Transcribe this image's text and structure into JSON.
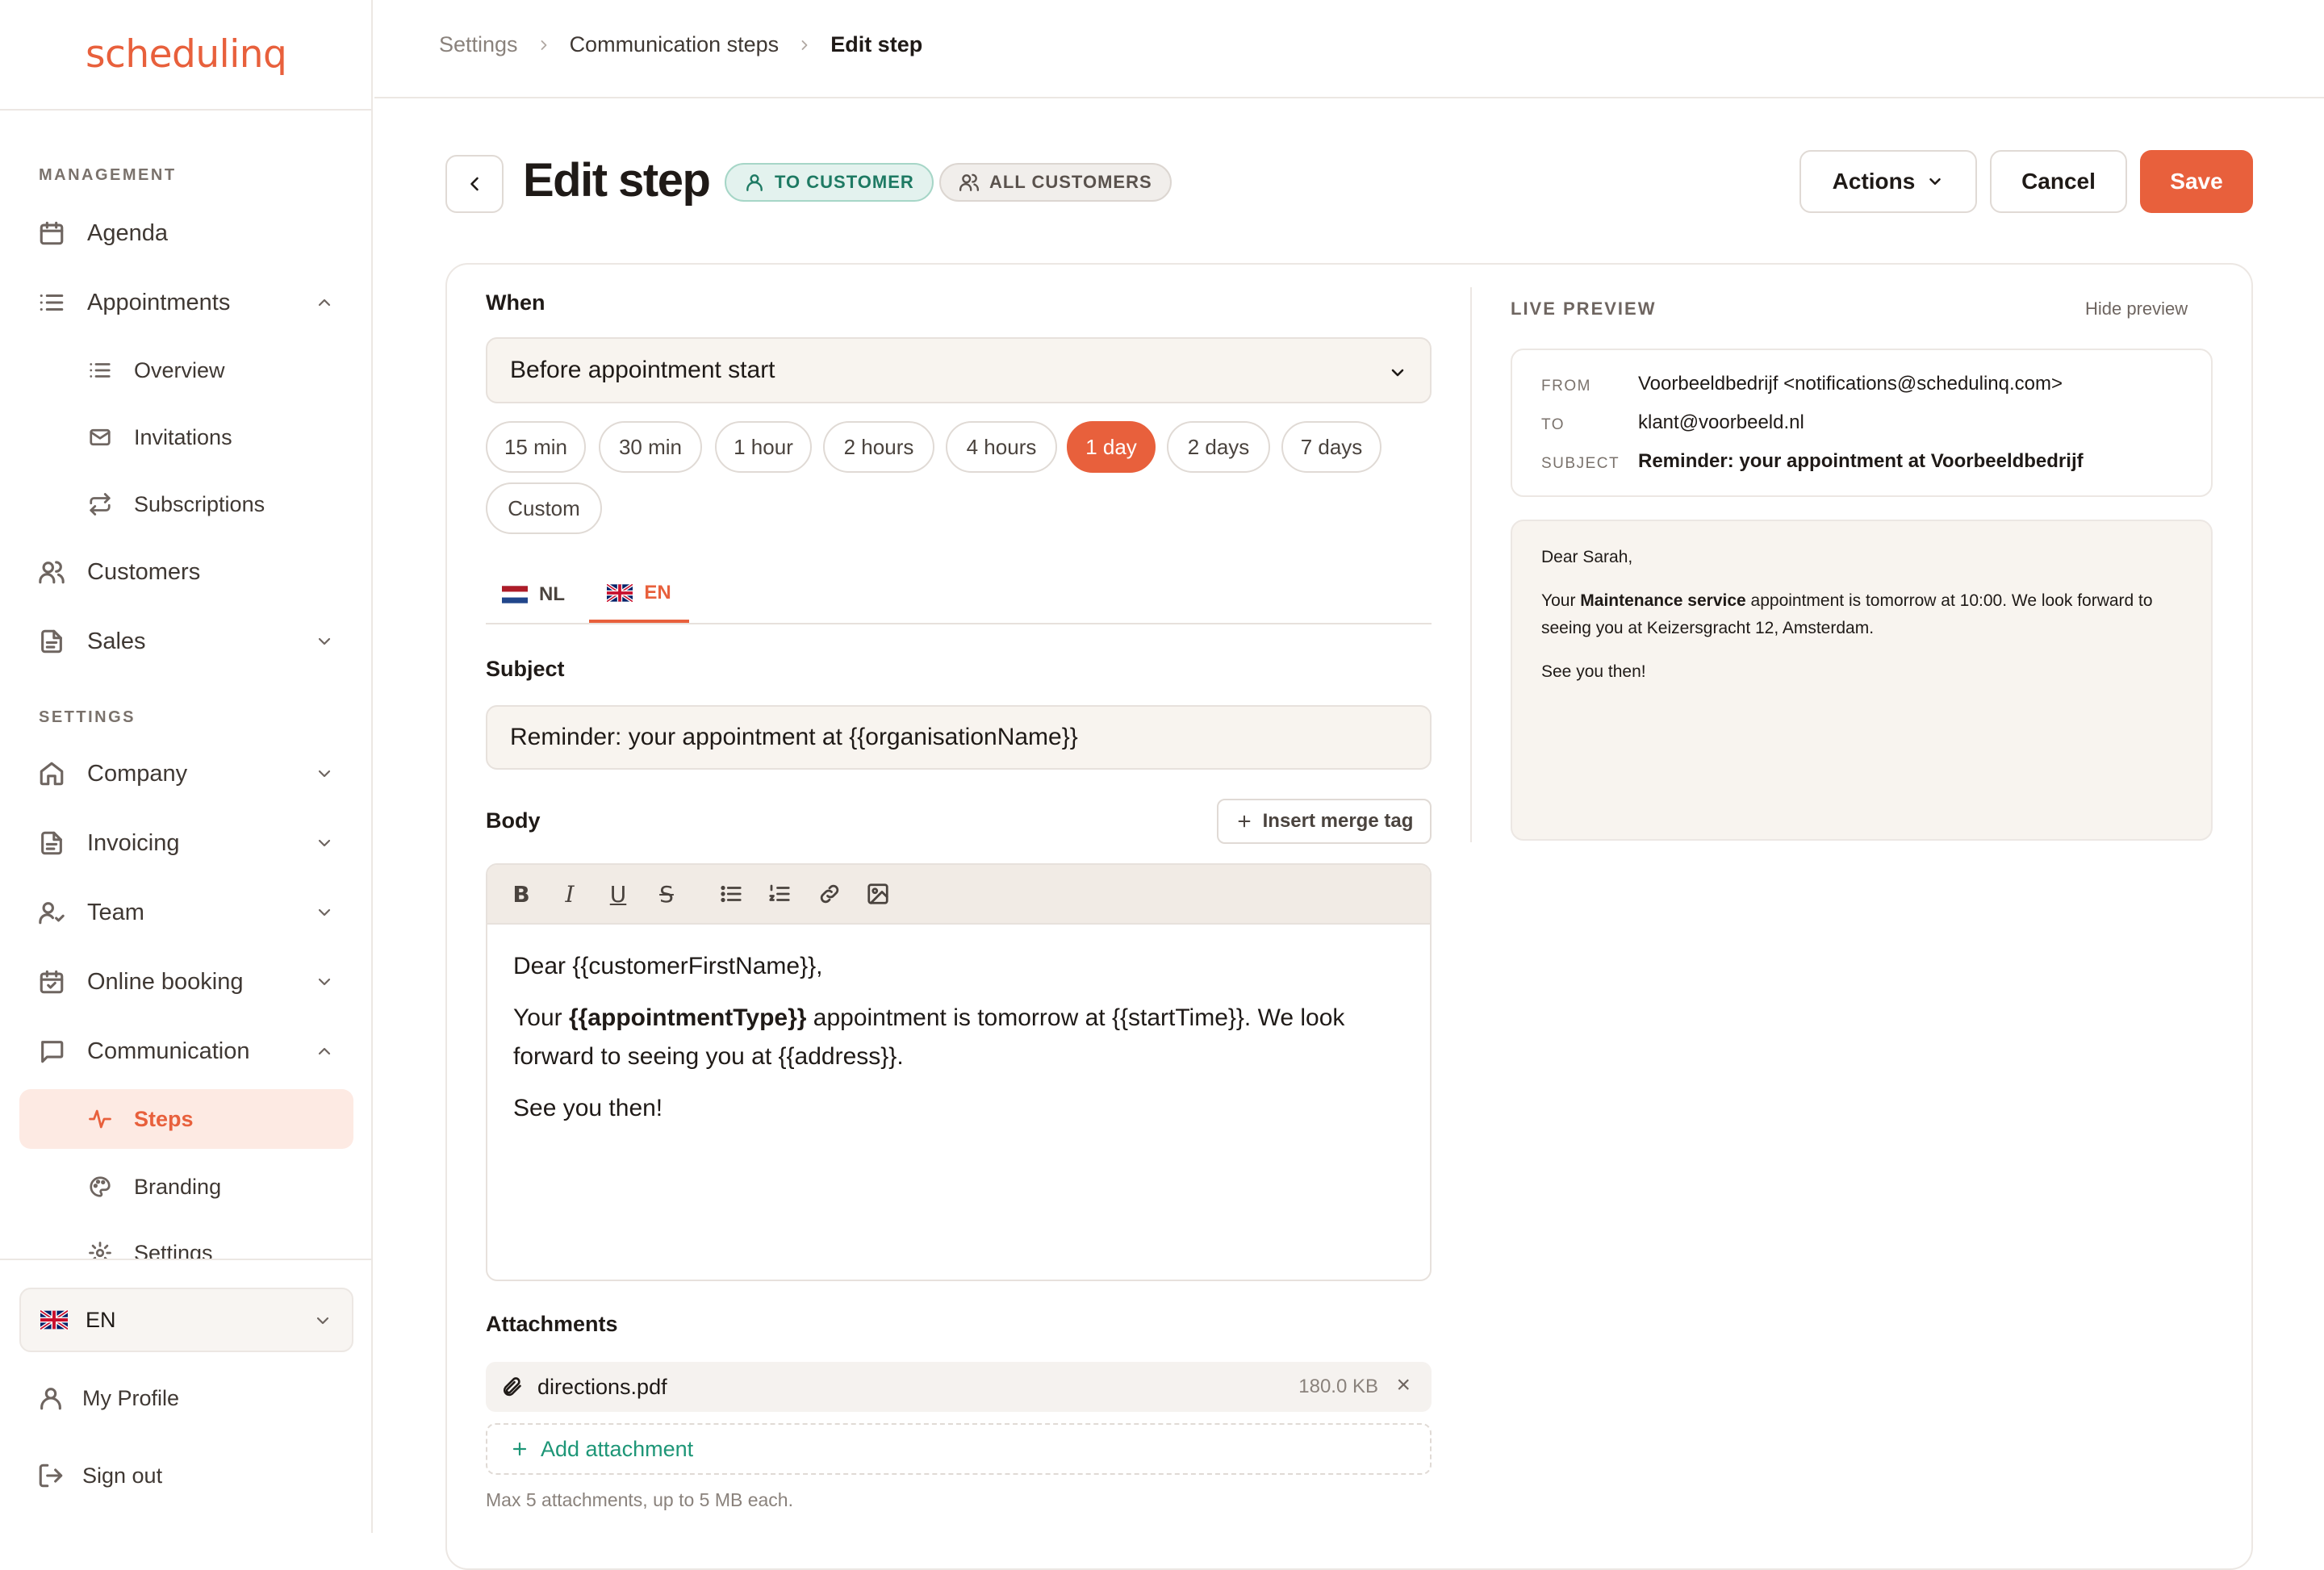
{
  "app": {
    "logo": "schedulinq"
  },
  "sidebar": {
    "management_label": "MANAGEMENT",
    "settings_label": "SETTINGS",
    "items": {
      "agenda": "Agenda",
      "appointments": "Appointments",
      "overview": "Overview",
      "invitations": "Invitations",
      "subscriptions": "Subscriptions",
      "customers": "Customers",
      "sales": "Sales",
      "company": "Company",
      "invoicing": "Invoicing",
      "team": "Team",
      "online_booking": "Online booking",
      "communication": "Communication",
      "steps": "Steps",
      "branding": "Branding",
      "settings": "Settings"
    },
    "language": "EN",
    "my_profile": "My Profile",
    "sign_out": "Sign out"
  },
  "breadcrumb": {
    "root": "Settings",
    "parent": "Communication steps",
    "current": "Edit step"
  },
  "header": {
    "title": "Edit step",
    "badge_recipient": "TO CUSTOMER",
    "badge_audience": "ALL CUSTOMERS",
    "actions_label": "Actions",
    "cancel_label": "Cancel",
    "save_label": "Save"
  },
  "form": {
    "when_label": "When",
    "when_value": "Before appointment start",
    "offsets": [
      "15 min",
      "30 min",
      "1 hour",
      "2 hours",
      "4 hours",
      "1 day",
      "2 days",
      "7 days",
      "Custom"
    ],
    "selected_offset": "1 day",
    "lang_tabs": {
      "nl": "NL",
      "en": "EN"
    },
    "active_lang": "EN",
    "subject_label": "Subject",
    "subject_value": "Reminder: your appointment at {{organisationName}}",
    "body_label": "Body",
    "insert_merge_tag": "Insert merge tag",
    "body": {
      "greeting": "Dear {{customerFirstName}},",
      "line2_pre": "Your ",
      "line2_bold": "{{appointmentType}}",
      "line2_post": " appointment is tomorrow at {{startTime}}. We look forward to seeing you at {{address}}.",
      "closing": "See you then!"
    },
    "attachments_label": "Attachments",
    "attachment": {
      "name": "directions.pdf",
      "size": "180.0 KB"
    },
    "add_attachment": "Add attachment",
    "attachments_hint": "Max 5 attachments, up to 5 MB each."
  },
  "preview": {
    "label": "LIVE PREVIEW",
    "hide": "Hide preview",
    "from_key": "FROM",
    "from_value": "Voorbeeldbedrijf <notifications@schedulinq.com>",
    "to_key": "TO",
    "to_value": "klant@voorbeeld.nl",
    "subject_key": "SUBJECT",
    "subject_value": "Reminder: your appointment at Voorbeeldbedrijf",
    "greeting": "Dear Sarah,",
    "line2_pre": "Your ",
    "line2_bold": "Maintenance service",
    "line2_post": " appointment is tomorrow at 10:00. We look forward to seeing you at Keizersgracht 12, Amsterdam.",
    "closing": "See you then!"
  },
  "colors": {
    "accent": "#e8603c",
    "teal": "#1e9677",
    "surface": "#f8f4ef"
  }
}
